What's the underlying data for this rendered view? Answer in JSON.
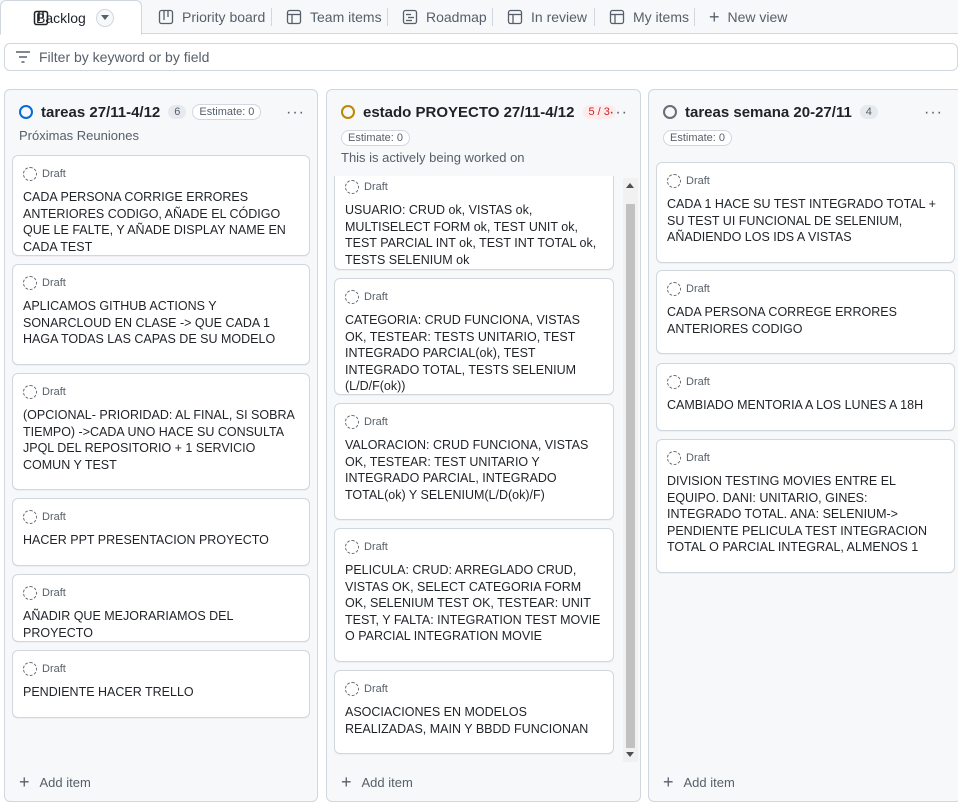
{
  "tabs": [
    {
      "label": "Backlog",
      "icon": "board-icon",
      "active": true
    },
    {
      "label": "Priority board",
      "icon": "board-icon"
    },
    {
      "label": "Team items",
      "icon": "table-icon"
    },
    {
      "label": "Roadmap",
      "icon": "roadmap-icon"
    },
    {
      "label": "In review",
      "icon": "table-icon"
    },
    {
      "label": "My items",
      "icon": "table-icon"
    },
    {
      "label": "New view",
      "icon": "plus-icon"
    }
  ],
  "filter": {
    "placeholder": "Filter by keyword or by field"
  },
  "columns": [
    {
      "title": "tareas 27/11-4/12",
      "count": "6",
      "estimate": "Estimate: 0",
      "description": "Próximas Reuniones",
      "status_color": "#0969da",
      "add_item": "Add item",
      "cards": [
        {
          "draft": "Draft",
          "text": "CADA PERSONA CORRIGE ERRORES ANTERIORES CODIGO, AÑADE EL CÓDIGO QUE LE FALTE, Y AÑADE DISPLAY NAME EN CADA TEST"
        },
        {
          "draft": "Draft",
          "text": "APLICAMOS GITHUB ACTIONS Y SONARCLOUD EN CLASE -> QUE CADA 1 HAGA TODAS LAS CAPAS DE SU MODELO"
        },
        {
          "draft": "Draft",
          "text": "(OPCIONAL- PRIORIDAD: AL FINAL, SI SOBRA TIEMPO) ->CADA UNO HACE SU CONSULTA JPQL DEL REPOSITORIO + 1 SERVICIO COMUN Y TEST"
        },
        {
          "draft": "Draft",
          "text": "HACER PPT PRESENTACION PROYECTO"
        },
        {
          "draft": "Draft",
          "text": "AÑADIR QUE MEJORARIAMOS DEL PROYECTO"
        },
        {
          "draft": "Draft",
          "text": "PENDIENTE HACER TRELLO"
        }
      ]
    },
    {
      "title": "estado PROYECTO 27/11-4/12",
      "count": "5 / 3",
      "estimate": "Estimate: 0",
      "description": "This is actively being worked on",
      "status_color": "#bf8700",
      "add_item": "Add item",
      "cards": [
        {
          "draft": "Draft",
          "text": "USUARIO: CRUD ok, VISTAS ok, MULTISELECT FORM ok, TEST UNIT ok, TEST PARCIAL INT ok, TEST INT TOTAL ok, TESTS SELENIUM ok"
        },
        {
          "draft": "Draft",
          "text": "CATEGORIA: CRUD FUNCIONA, VISTAS OK, TESTEAR: TESTS UNITARIO, TEST INTEGRADO PARCIAL(ok), TEST INTEGRADO TOTAL, TESTS SELENIUM (L/D/F(ok))"
        },
        {
          "draft": "Draft",
          "text": "VALORACION: CRUD FUNCIONA, VISTAS OK, TESTEAR: TEST UNITARIO Y INTEGRADO PARCIAL, INTEGRADO TOTAL(ok) Y SELENIUM(L/D(ok)/F)"
        },
        {
          "draft": "Draft",
          "text": "PELICULA: CRUD: ARREGLADO CRUD, VISTAS OK, SELECT CATEGORIA FORM OK, SELENIUM TEST OK, TESTEAR: UNIT TEST, Y FALTA: INTEGRATION TEST MOVIE O PARCIAL INTEGRATION MOVIE"
        },
        {
          "draft": "Draft",
          "text": "ASOCIACIONES EN MODELOS REALIZADAS, MAIN Y BBDD FUNCIONAN"
        }
      ]
    },
    {
      "title": "tareas semana 20-27/11",
      "count": "4",
      "estimate": "Estimate: 0",
      "status_color": "#656d76",
      "add_item": "Add item",
      "cards": [
        {
          "draft": "Draft",
          "text": "CADA 1 HACE SU TEST INTEGRADO TOTAL + SU TEST UI FUNCIONAL DE SELENIUM, AÑADIENDO LOS IDS A VISTAS"
        },
        {
          "draft": "Draft",
          "text": "CADA PERSONA CORREGE ERRORES ANTERIORES CODIGO"
        },
        {
          "draft": "Draft",
          "text": "CAMBIADO MENTORIA A LOS LUNES A 18H"
        },
        {
          "draft": "Draft",
          "text": "DIVISION TESTING MOVIES ENTRE EL EQUIPO. DANI: UNITARIO, GINES: INTEGRADO TOTAL. ANA: SELENIUM-> PENDIENTE PELICULA TEST INTEGRACION TOTAL O PARCIAL INTEGRAL, ALMENOS 1"
        }
      ]
    }
  ]
}
